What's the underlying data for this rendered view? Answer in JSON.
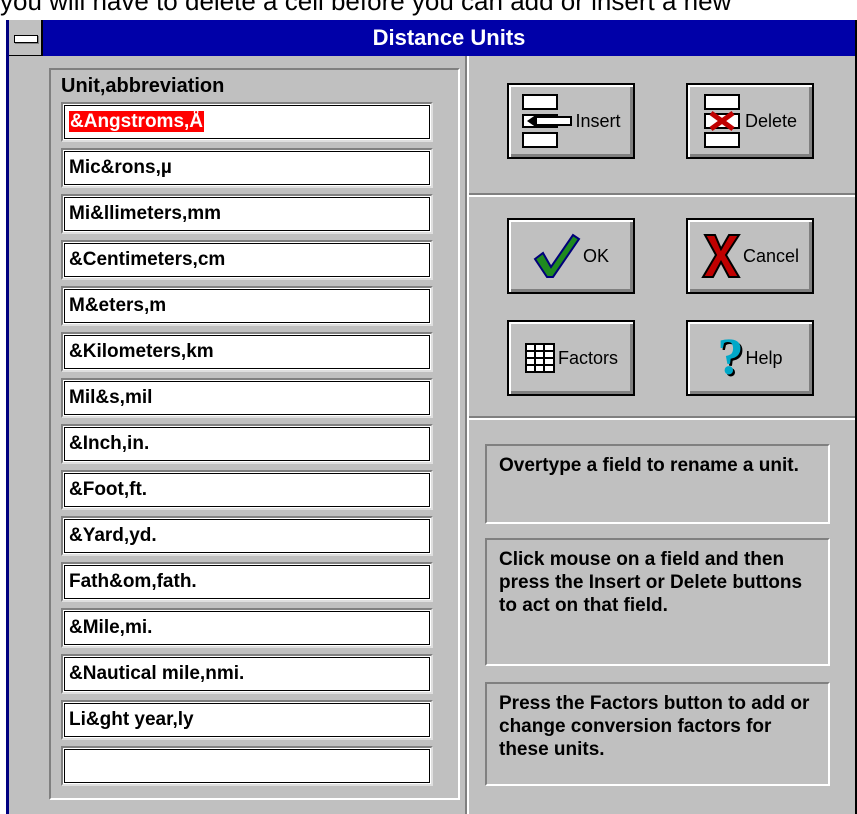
{
  "background_text": "you will have to delete a cell before you can add or insert a new",
  "window": {
    "title": "Distance Units"
  },
  "list": {
    "label": "Unit,abbreviation",
    "selected_index": 0,
    "fields": [
      "&Angstroms,Å",
      "Mic&rons,µ",
      "Mi&llimeters,mm",
      "&Centimeters,cm",
      "M&eters,m",
      "&Kilometers,km",
      "Mil&s,mil",
      "&Inch,in.",
      "&Foot,ft.",
      "&Yard,yd.",
      "Fath&om,fath.",
      "&Mile,mi.",
      "&Nautical mile,nmi.",
      "Li&ght year,ly",
      ""
    ]
  },
  "buttons": {
    "insert": "Insert",
    "delete": "Delete",
    "ok": "OK",
    "cancel": "Cancel",
    "factors": "Factors",
    "help": "Help"
  },
  "notes": [
    "Overtype a field to rename a unit.",
    "Click mouse on a field and then press the Insert or Delete buttons to act on that field.",
    "Press the Factors button to add or change conversion factors for these units."
  ],
  "colors": {
    "title_bar": "#0000a8",
    "dialog_face": "#c0c0c0",
    "selection": "#ff0000",
    "ok_check": "#1f8a1f",
    "cancel_x": "#c00000",
    "help_mark": "#00a8c8"
  }
}
